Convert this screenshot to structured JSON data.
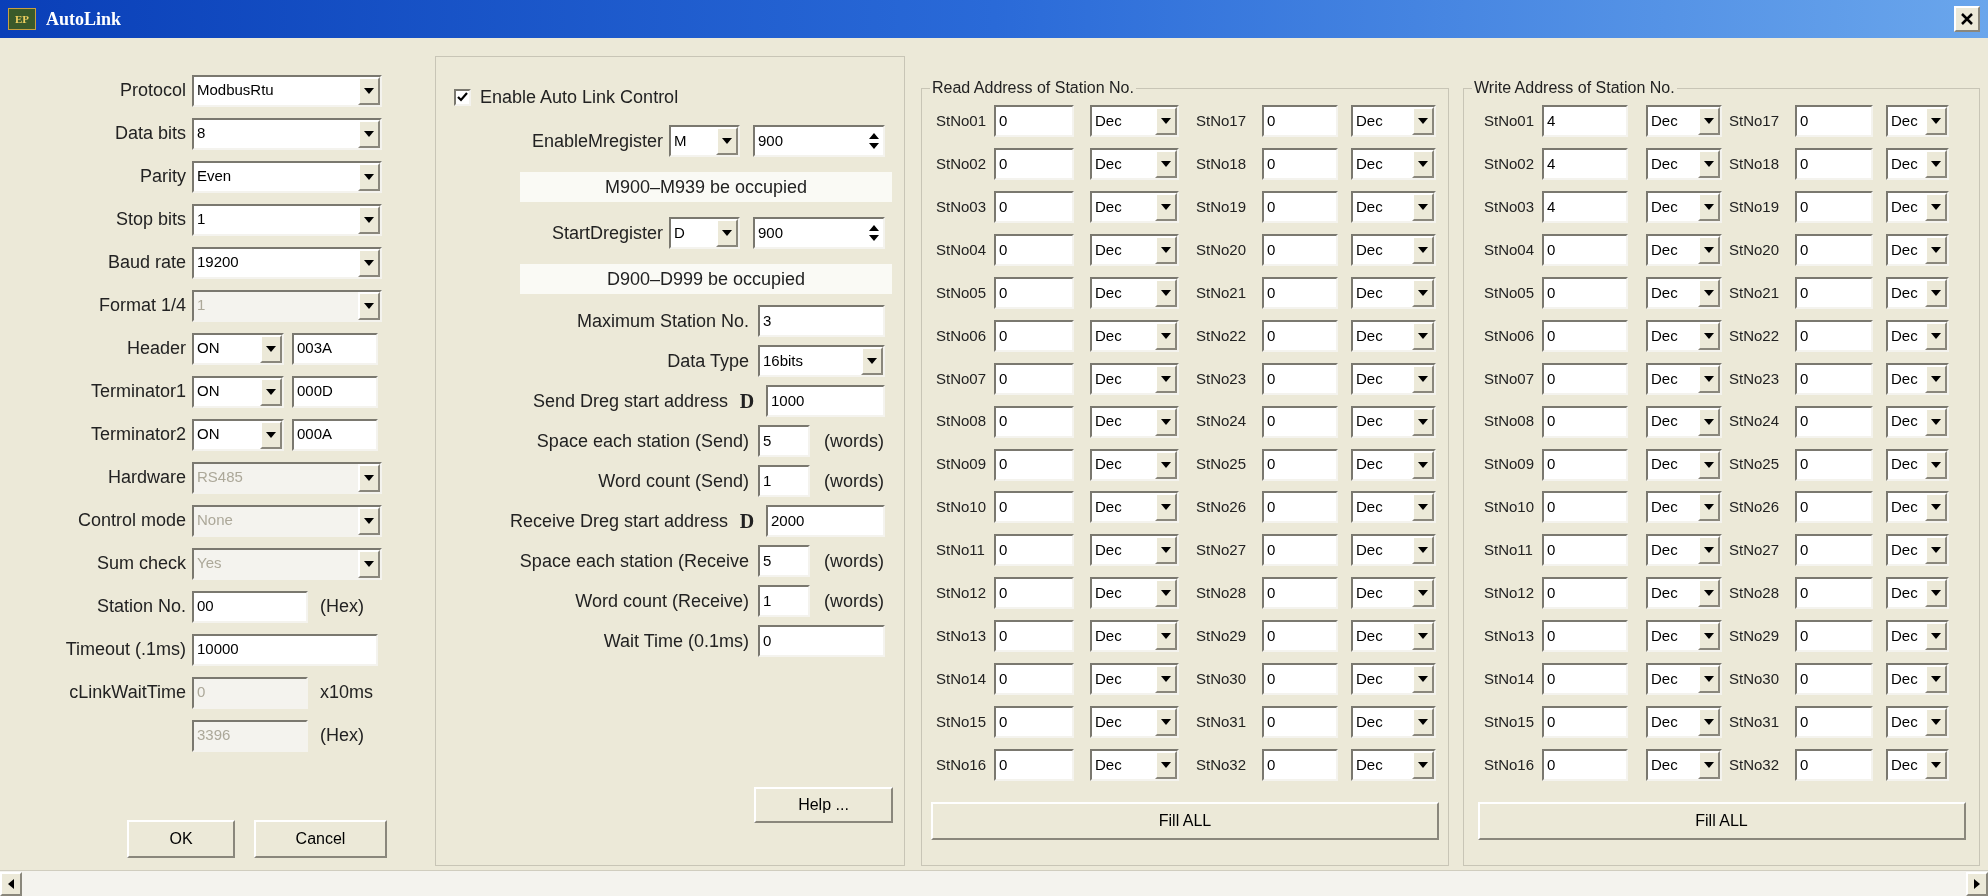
{
  "window": {
    "icon_text": "EP",
    "title": "AutoLink"
  },
  "settings": [
    {
      "label": "Protocol",
      "kind": "combo",
      "value": "ModbusRtu",
      "disabled": false
    },
    {
      "label": "Data bits",
      "kind": "combo",
      "value": "8",
      "disabled": false
    },
    {
      "label": "Parity",
      "kind": "combo",
      "value": "Even",
      "disabled": false
    },
    {
      "label": "Stop bits",
      "kind": "combo",
      "value": "1",
      "disabled": false
    },
    {
      "label": "Baud rate",
      "kind": "combo",
      "value": "19200",
      "disabled": false
    },
    {
      "label": "Format 1/4",
      "kind": "combo",
      "value": "1",
      "disabled": true
    },
    {
      "label": "Header",
      "kind": "pair",
      "value": "ON",
      "value2": "003A",
      "disabled": false
    },
    {
      "label": "Terminator1",
      "kind": "pair",
      "value": "ON",
      "value2": "000D",
      "disabled": false
    },
    {
      "label": "Terminator2",
      "kind": "pair",
      "value": "ON",
      "value2": "000A",
      "disabled": false
    },
    {
      "label": "Hardware",
      "kind": "combo",
      "value": "RS485",
      "disabled": true
    },
    {
      "label": "Control mode",
      "kind": "combo",
      "value": "None",
      "disabled": true
    },
    {
      "label": "Sum check",
      "kind": "combo",
      "value": "Yes",
      "disabled": true
    },
    {
      "label": "Station No.",
      "kind": "short",
      "value": "00",
      "unit": "(Hex)",
      "disabled": false
    },
    {
      "label": "Timeout (.1ms)",
      "kind": "wide",
      "value": "10000",
      "disabled": false
    },
    {
      "label": "cLinkWaitTime",
      "kind": "short",
      "value": "0",
      "unit": "x10ms",
      "disabled": true
    },
    {
      "kind": "short",
      "value": "3396",
      "unit": "(Hex)",
      "disabled": true
    }
  ],
  "buttons": [
    "OK",
    "Cancel"
  ],
  "auto_link": {
    "enable": {
      "label": "Enable Auto Link Control",
      "checked": true
    },
    "rows": [
      {
        "kind": "register",
        "label": "EnableMregister",
        "register": "M",
        "value": "900"
      },
      {
        "kind": "info",
        "text": "M900–M939 be occupied"
      },
      {
        "kind": "register",
        "label": "StartDregister",
        "register": "D",
        "value": "900"
      },
      {
        "kind": "info",
        "text": "D900–D999 be occupied"
      },
      {
        "kind": "field",
        "label": "Maximum Station No.",
        "value": "3"
      },
      {
        "kind": "combo",
        "label": "Data Type",
        "value": "16bits"
      },
      {
        "kind": "dfield",
        "label": "Send Dreg start address",
        "prefix": "D",
        "value": "1000"
      },
      {
        "kind": "unit",
        "label": "Space each station (Send)",
        "value": "5",
        "unit": "(words)"
      },
      {
        "kind": "unit",
        "label": "Word count (Send)",
        "value": "1",
        "unit": "(words)"
      },
      {
        "kind": "dfield",
        "label": "Receive Dreg start address",
        "prefix": "D",
        "value": "2000"
      },
      {
        "kind": "unit",
        "label": "Space each station (Receive",
        "value": "5",
        "unit": "(words)"
      },
      {
        "kind": "unit",
        "label": "Word count (Receive)",
        "value": "1",
        "unit": "(words)"
      },
      {
        "kind": "field",
        "label": "Wait Time (0.1ms)",
        "value": "0"
      }
    ],
    "help_button": "Help ..."
  },
  "read_group": {
    "title": "Read Address of Station No.",
    "fill_button": "Fill ALL",
    "stations": [
      {
        "label": "StNo01",
        "value": "0",
        "format": "Dec"
      },
      {
        "label": "StNo02",
        "value": "0",
        "format": "Dec"
      },
      {
        "label": "StNo03",
        "value": "0",
        "format": "Dec"
      },
      {
        "label": "StNo04",
        "value": "0",
        "format": "Dec"
      },
      {
        "label": "StNo05",
        "value": "0",
        "format": "Dec"
      },
      {
        "label": "StNo06",
        "value": "0",
        "format": "Dec"
      },
      {
        "label": "StNo07",
        "value": "0",
        "format": "Dec"
      },
      {
        "label": "StNo08",
        "value": "0",
        "format": "Dec"
      },
      {
        "label": "StNo09",
        "value": "0",
        "format": "Dec"
      },
      {
        "label": "StNo10",
        "value": "0",
        "format": "Dec"
      },
      {
        "label": "StNo11",
        "value": "0",
        "format": "Dec"
      },
      {
        "label": "StNo12",
        "value": "0",
        "format": "Dec"
      },
      {
        "label": "StNo13",
        "value": "0",
        "format": "Dec"
      },
      {
        "label": "StNo14",
        "value": "0",
        "format": "Dec"
      },
      {
        "label": "StNo15",
        "value": "0",
        "format": "Dec"
      },
      {
        "label": "StNo16",
        "value": "0",
        "format": "Dec"
      },
      {
        "label": "StNo17",
        "value": "0",
        "format": "Dec"
      },
      {
        "label": "StNo18",
        "value": "0",
        "format": "Dec"
      },
      {
        "label": "StNo19",
        "value": "0",
        "format": "Dec"
      },
      {
        "label": "StNo20",
        "value": "0",
        "format": "Dec"
      },
      {
        "label": "StNo21",
        "value": "0",
        "format": "Dec"
      },
      {
        "label": "StNo22",
        "value": "0",
        "format": "Dec"
      },
      {
        "label": "StNo23",
        "value": "0",
        "format": "Dec"
      },
      {
        "label": "StNo24",
        "value": "0",
        "format": "Dec"
      },
      {
        "label": "StNo25",
        "value": "0",
        "format": "Dec"
      },
      {
        "label": "StNo26",
        "value": "0",
        "format": "Dec"
      },
      {
        "label": "StNo27",
        "value": "0",
        "format": "Dec"
      },
      {
        "label": "StNo28",
        "value": "0",
        "format": "Dec"
      },
      {
        "label": "StNo29",
        "value": "0",
        "format": "Dec"
      },
      {
        "label": "StNo30",
        "value": "0",
        "format": "Dec"
      },
      {
        "label": "StNo31",
        "value": "0",
        "format": "Dec"
      },
      {
        "label": "StNo32",
        "value": "0",
        "format": "Dec"
      }
    ]
  },
  "write_group": {
    "title": "Write Address of Station No.",
    "fill_button": "Fill ALL",
    "stations": [
      {
        "label": "StNo01",
        "value": "4",
        "format": "Dec"
      },
      {
        "label": "StNo02",
        "value": "4",
        "format": "Dec"
      },
      {
        "label": "StNo03",
        "value": "4",
        "format": "Dec"
      },
      {
        "label": "StNo04",
        "value": "0",
        "format": "Dec"
      },
      {
        "label": "StNo05",
        "value": "0",
        "format": "Dec"
      },
      {
        "label": "StNo06",
        "value": "0",
        "format": "Dec"
      },
      {
        "label": "StNo07",
        "value": "0",
        "format": "Dec"
      },
      {
        "label": "StNo08",
        "value": "0",
        "format": "Dec"
      },
      {
        "label": "StNo09",
        "value": "0",
        "format": "Dec"
      },
      {
        "label": "StNo10",
        "value": "0",
        "format": "Dec"
      },
      {
        "label": "StNo11",
        "value": "0",
        "format": "Dec"
      },
      {
        "label": "StNo12",
        "value": "0",
        "format": "Dec"
      },
      {
        "label": "StNo13",
        "value": "0",
        "format": "Dec"
      },
      {
        "label": "StNo14",
        "value": "0",
        "format": "Dec"
      },
      {
        "label": "StNo15",
        "value": "0",
        "format": "Dec"
      },
      {
        "label": "StNo16",
        "value": "0",
        "format": "Dec"
      },
      {
        "label": "StNo17",
        "value": "0",
        "format": "Dec"
      },
      {
        "label": "StNo18",
        "value": "0",
        "format": "Dec"
      },
      {
        "label": "StNo19",
        "value": "0",
        "format": "Dec"
      },
      {
        "label": "StNo20",
        "value": "0",
        "format": "Dec"
      },
      {
        "label": "StNo21",
        "value": "0",
        "format": "Dec"
      },
      {
        "label": "StNo22",
        "value": "0",
        "format": "Dec"
      },
      {
        "label": "StNo23",
        "value": "0",
        "format": "Dec"
      },
      {
        "label": "StNo24",
        "value": "0",
        "format": "Dec"
      },
      {
        "label": "StNo25",
        "value": "0",
        "format": "Dec"
      },
      {
        "label": "StNo26",
        "value": "0",
        "format": "Dec"
      },
      {
        "label": "StNo27",
        "value": "0",
        "format": "Dec"
      },
      {
        "label": "StNo28",
        "value": "0",
        "format": "Dec"
      },
      {
        "label": "StNo29",
        "value": "0",
        "format": "Dec"
      },
      {
        "label": "StNo30",
        "value": "0",
        "format": "Dec"
      },
      {
        "label": "StNo31",
        "value": "0",
        "format": "Dec"
      },
      {
        "label": "StNo32",
        "value": "0",
        "format": "Dec"
      }
    ]
  }
}
